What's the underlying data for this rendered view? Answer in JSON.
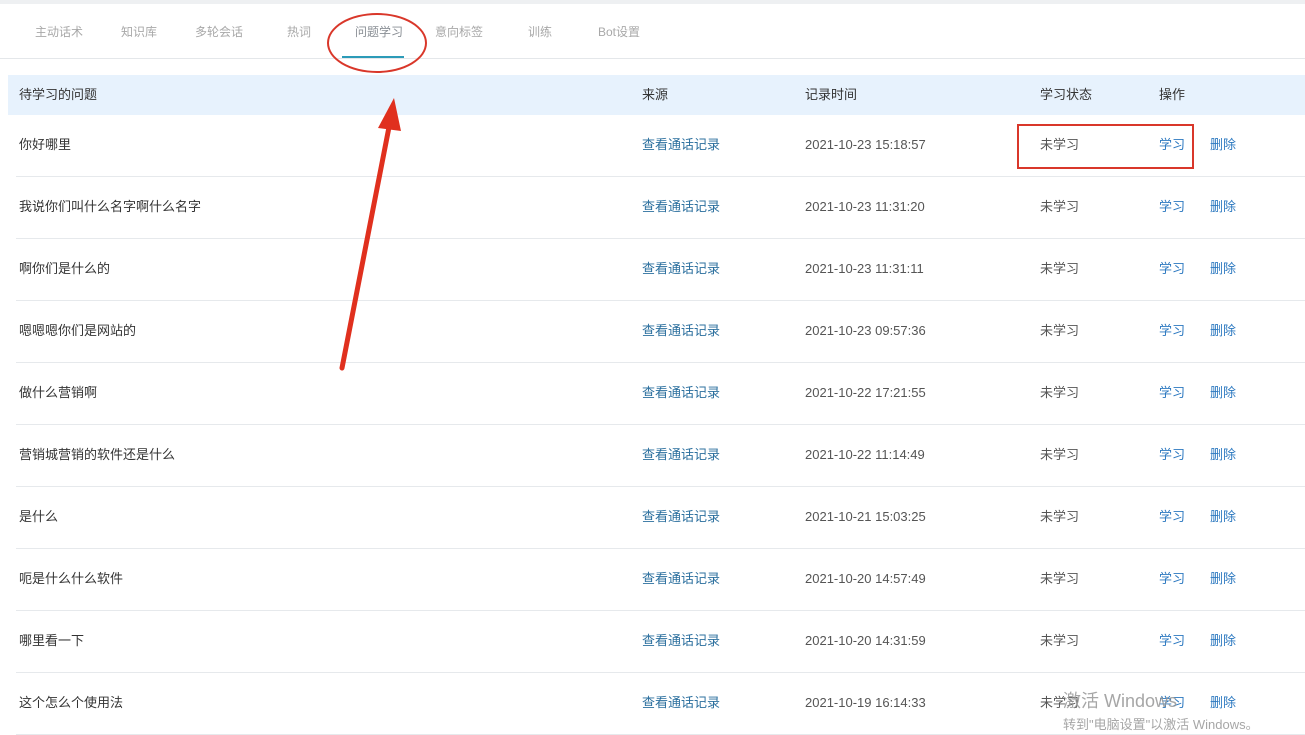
{
  "tabs": [
    {
      "label": "主动话术"
    },
    {
      "label": "知识库"
    },
    {
      "label": "多轮会话"
    },
    {
      "label": "热词"
    },
    {
      "label": "问题学习"
    },
    {
      "label": "意向标签"
    },
    {
      "label": "训练"
    },
    {
      "label": "Bot设置"
    }
  ],
  "active_tab": "问题学习",
  "table": {
    "headers": {
      "question": "待学习的问题",
      "source": "来源",
      "time": "记录时间",
      "state": "学习状态",
      "actions": "操作"
    },
    "rows": [
      {
        "question": "你好哪里",
        "source": "查看通话记录",
        "time": "2021-10-23 15:18:57",
        "state": "未学习",
        "learn": "学习",
        "delete": "删除"
      },
      {
        "question": "我说你们叫什么名字啊什么名字",
        "source": "查看通话记录",
        "time": "2021-10-23 11:31:20",
        "state": "未学习",
        "learn": "学习",
        "delete": "删除"
      },
      {
        "question": "啊你们是什么的",
        "source": "查看通话记录",
        "time": "2021-10-23 11:31:11",
        "state": "未学习",
        "learn": "学习",
        "delete": "删除"
      },
      {
        "question": "嗯嗯嗯你们是网站的",
        "source": "查看通话记录",
        "time": "2021-10-23 09:57:36",
        "state": "未学习",
        "learn": "学习",
        "delete": "删除"
      },
      {
        "question": "做什么营销啊",
        "source": "查看通话记录",
        "time": "2021-10-22 17:21:55",
        "state": "未学习",
        "learn": "学习",
        "delete": "删除"
      },
      {
        "question": "营销城营销的软件还是什么",
        "source": "查看通话记录",
        "time": "2021-10-22 11:14:49",
        "state": "未学习",
        "learn": "学习",
        "delete": "删除"
      },
      {
        "question": "是什么",
        "source": "查看通话记录",
        "time": "2021-10-21 15:03:25",
        "state": "未学习",
        "learn": "学习",
        "delete": "删除"
      },
      {
        "question": "呃是什么什么软件",
        "source": "查看通话记录",
        "time": "2021-10-20 14:57:49",
        "state": "未学习",
        "learn": "学习",
        "delete": "删除"
      },
      {
        "question": "哪里看一下",
        "source": "查看通话记录",
        "time": "2021-10-20 14:31:59",
        "state": "未学习",
        "learn": "学习",
        "delete": "删除"
      },
      {
        "question": "这个怎么个使用法",
        "source": "查看通话记录",
        "time": "2021-10-19 16:14:33",
        "state": "未学习",
        "learn": "学习",
        "delete": "删除"
      }
    ]
  },
  "watermark": {
    "line1": "激活 Windows",
    "line2": "转到\"电脑设置\"以激活 Windows。"
  },
  "colors": {
    "accent": "#2c9bb8",
    "link": "#2b78c0",
    "header_bg": "#e7f2fd",
    "annotation": "#d9372a"
  }
}
